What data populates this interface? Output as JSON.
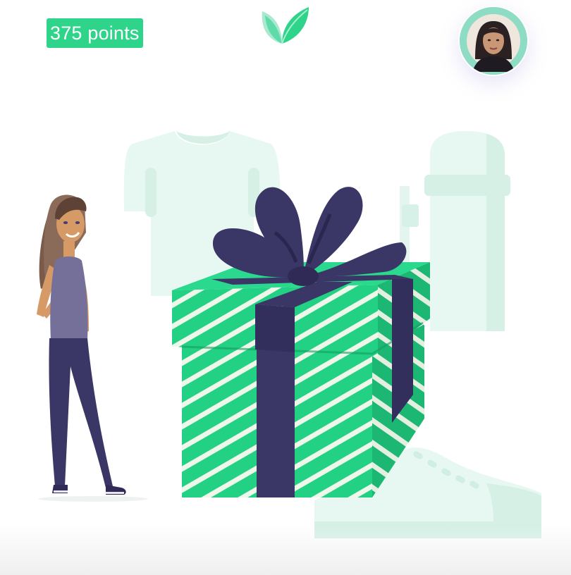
{
  "header": {
    "points_label": "375 points",
    "logo_icon": "leaf-icon",
    "avatar_icon": "user-avatar"
  },
  "illustration": {
    "scene": "rewards-gift-illustration",
    "items": [
      "tshirt-icon",
      "thermos-icon",
      "gift-box-icon",
      "sneaker-icon",
      "person-with-phone-illustration"
    ]
  },
  "colors": {
    "brand_green": "#2dd48a",
    "ribbon_navy": "#3a3666",
    "pale_mint": "#e6f7f1",
    "avatar_ring": "#8fdcc4"
  }
}
